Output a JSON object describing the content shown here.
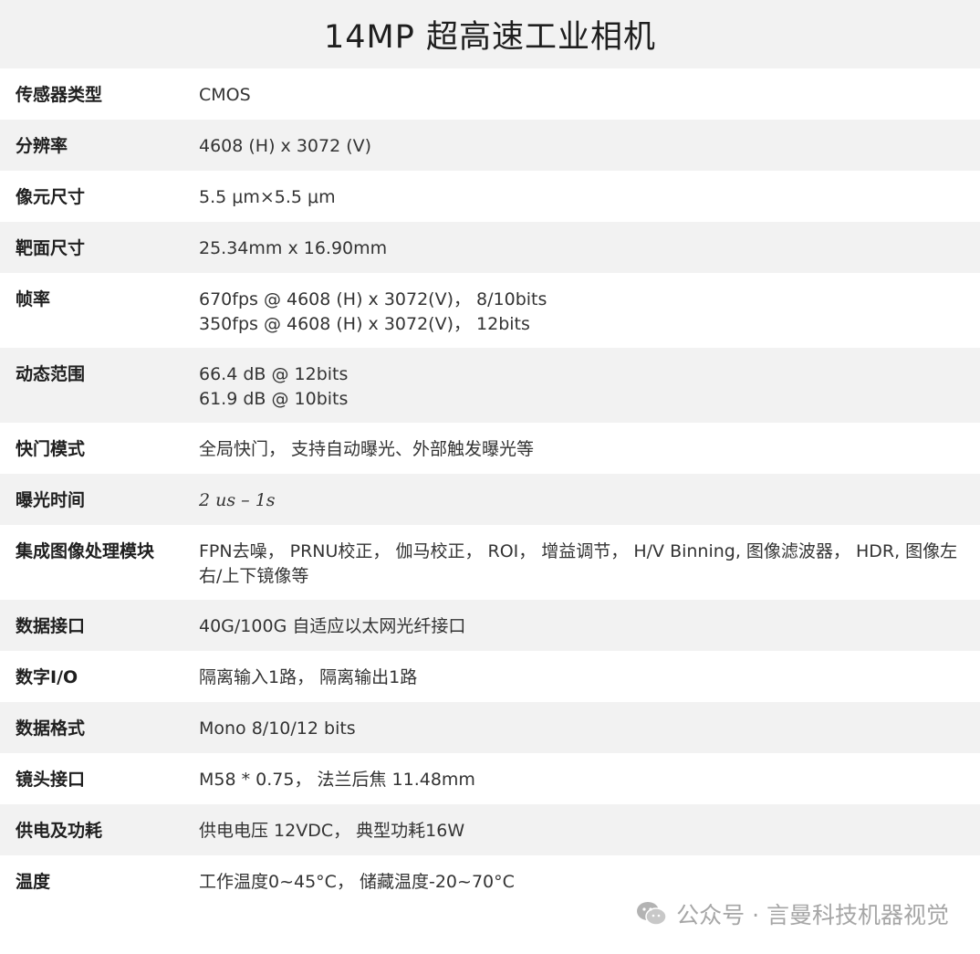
{
  "header": {
    "title": "14MP 超高速工业相机"
  },
  "specs": [
    {
      "label": "传感器类型",
      "lines": [
        "CMOS"
      ]
    },
    {
      "label": "分辨率",
      "lines": [
        "4608 (H) x 3072 (V)"
      ]
    },
    {
      "label": "像元尺寸",
      "lines": [
        "5.5 μm×5.5 μm"
      ]
    },
    {
      "label": "靶面尺寸",
      "lines": [
        "25.34mm x 16.90mm"
      ]
    },
    {
      "label": "帧率",
      "lines": [
        "670fps @ 4608 (H) x 3072(V)， 8/10bits",
        "350fps @ 4608 (H) x 3072(V)， 12bits"
      ]
    },
    {
      "label": "动态范围",
      "lines": [
        "66.4 dB @ 12bits",
        "61.9 dB @ 10bits"
      ]
    },
    {
      "label": "快门模式",
      "lines": [
        "全局快门， 支持自动曝光、外部触发曝光等"
      ]
    },
    {
      "label": "曝光时间",
      "lines": [
        "2 us – 1s"
      ]
    },
    {
      "label": "集成图像处理模块",
      "lines": [
        "FPN去噪， PRNU校正， 伽马校正， ROI， 增益调节， H/V Binning, 图像滤波器， HDR, 图像左右/上下镜像等"
      ]
    },
    {
      "label": "数据接口",
      "lines": [
        "40G/100G 自适应以太网光纤接口"
      ]
    },
    {
      "label": "数字I/O",
      "lines": [
        "隔离输入1路， 隔离输出1路"
      ]
    },
    {
      "label": "数据格式",
      "lines": [
        "Mono 8/10/12 bits"
      ]
    },
    {
      "label": "镜头接口",
      "lines": [
        "M58 * 0.75， 法兰后焦 11.48mm"
      ]
    },
    {
      "label": "供电及功耗",
      "lines": [
        "供电电压 12VDC， 典型功耗16W"
      ]
    },
    {
      "label": "温度",
      "lines": [
        "工作温度0~45°C， 储藏温度-20~70°C"
      ]
    }
  ],
  "watermark": {
    "text": "公众号 · 言曼科技机器视觉",
    "icon": "wechat-icon",
    "color": "#a6a6a6"
  },
  "colors": {
    "stripe": "#f2f2f2",
    "background": "#ffffff"
  }
}
